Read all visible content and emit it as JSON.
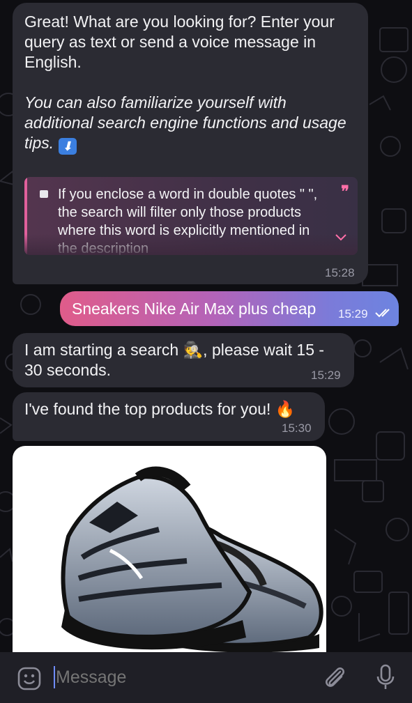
{
  "messages": {
    "intro": {
      "paragraph1": "Great! What are you looking for? Enter your query as text or send a voice message in English.",
      "paragraph2_text": "You can also familiarize yourself with additional search engine functions and usage tips.",
      "paragraph2_emoji": "⬇",
      "quote_text": "If you enclose a word in double quotes \" \", the search will filter only those products where this word is explicitly mentioned in the description",
      "quote_mark": "❞",
      "time": "15:28"
    },
    "outgoing": {
      "text": "Sneakers Nike Air Max plus cheap",
      "time": "15:29"
    },
    "searching": {
      "text": "I am starting a search 🕵, please wait 15 - 30 seconds.",
      "time": "15:29"
    },
    "found": {
      "text": "I've found the top products for you! 🔥",
      "time": "15:30"
    }
  },
  "composer": {
    "placeholder": "Message"
  },
  "icons": {
    "emoji": "emoji-icon",
    "attach": "paperclip-icon",
    "voice": "microphone-icon",
    "read_status": "double-check-icon"
  },
  "colors": {
    "outgoing_gradient_start": "#e05c8a",
    "outgoing_gradient_end": "#6d84e0",
    "incoming_bubble": "#2b2b33",
    "quote_accent": "#e0609c"
  }
}
